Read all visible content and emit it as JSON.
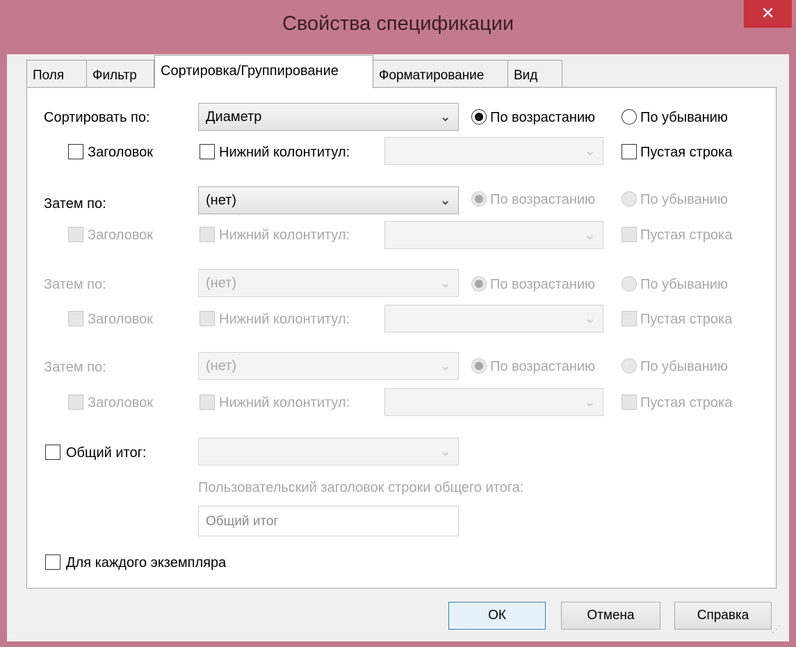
{
  "window": {
    "title": "Свойства спецификации",
    "close_label": "✕"
  },
  "tabs": [
    "Поля",
    "Фильтр",
    "Сортировка/Группирование",
    "Форматирование",
    "Вид"
  ],
  "sort_by": {
    "label": "Сортировать по:",
    "value": "Диаметр",
    "ascending": "По возрастанию",
    "descending": "По убыванию",
    "header": "Заголовок",
    "footer": "Нижний колонтитул:",
    "blank_line": "Пустая строка"
  },
  "then_by": [
    {
      "label": "Затем по:",
      "value": "(нет)",
      "ascending": "По возрастанию",
      "descending": "По убыванию",
      "header": "Заголовок",
      "footer": "Нижний колонтитул:",
      "blank_line": "Пустая строка"
    },
    {
      "label": "Затем по:",
      "value": "(нет)",
      "ascending": "По возрастанию",
      "descending": "По убыванию",
      "header": "Заголовок",
      "footer": "Нижний колонтитул:",
      "blank_line": "Пустая строка"
    },
    {
      "label": "Затем по:",
      "value": "(нет)",
      "ascending": "По возрастанию",
      "descending": "По убыванию",
      "header": "Заголовок",
      "footer": "Нижний колонтитул:",
      "blank_line": "Пустая строка"
    }
  ],
  "grand_total": {
    "label": "Общий итог:",
    "custom_title_label": "Пользовательский заголовок строки общего итога:",
    "custom_title_value": "Общий итог"
  },
  "per_instance": "Для каждого экземпляра",
  "buttons": {
    "ok": "ОК",
    "cancel": "Отмена",
    "help": "Справка"
  },
  "icons": {
    "close": "close-icon",
    "dropdown": "chevron-down-icon",
    "grip": "resize-grip-icon"
  },
  "colors": {
    "titlebar": "#c47a8e",
    "close_button": "#c7343d",
    "disabled_text": "#a8a8a8"
  }
}
